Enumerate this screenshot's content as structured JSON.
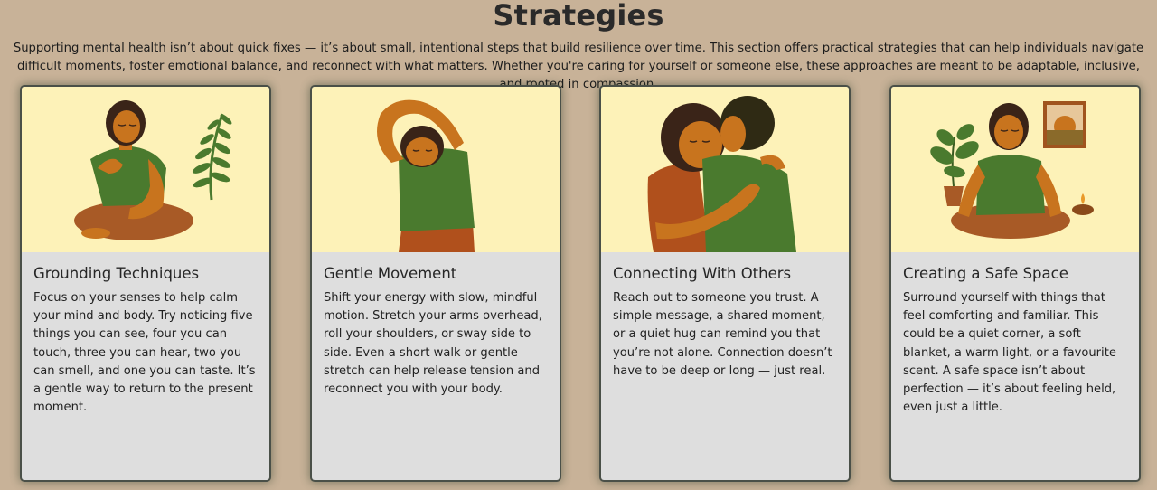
{
  "section": {
    "title": "Strategies",
    "intro": "Supporting mental health isn’t about quick fixes — it’s about small, intentional steps that build resilience over time. This section offers practical strategies that can help individuals navigate difficult moments, foster emotional balance, and reconnect with what matters. Whether you're caring for yourself or someone else, these approaches are meant to be adaptable, inclusive, and rooted in compassion."
  },
  "colors": {
    "background": "#c8b298",
    "card": "#dedede",
    "art_bg": "#fdf2b8",
    "shirt_green": "#4a7a2e",
    "skin": "#c8741e",
    "hair": "#3a2418",
    "rust": "#b0501c"
  },
  "cards": [
    {
      "title": "Grounding Techniques",
      "body": "Focus on your senses to help calm your mind and body. Try noticing five things you can see, four you can touch, three you can hear, two you can smell, and one you can taste. It’s a gentle way to return to the present moment.",
      "illustration": "seated-person-hand-on-chest-with-fern"
    },
    {
      "title": "Gentle Movement",
      "body": "Shift your energy with slow, mindful motion. Stretch your arms overhead, roll your shoulders, or sway side to side. Even a short walk or gentle stretch can help release tension and reconnect you with your body.",
      "illustration": "person-stretching-arm-overhead"
    },
    {
      "title": "Connecting With Others",
      "body": "Reach out to someone you trust. A simple message, a shared moment, or a quiet hug can remind you that you’re not alone. Connection doesn’t have to be deep or long — just real.",
      "illustration": "two-people-hugging"
    },
    {
      "title": "Creating a Safe Space",
      "body": "Surround yourself with things that feel comforting and familiar. This could be a quiet corner, a soft blanket, a warm light, or a favourite scent. A safe space isn’t about perfection — it’s about feeling held, even just a little.",
      "illustration": "seated-person-with-plant-candle-picture"
    }
  ]
}
